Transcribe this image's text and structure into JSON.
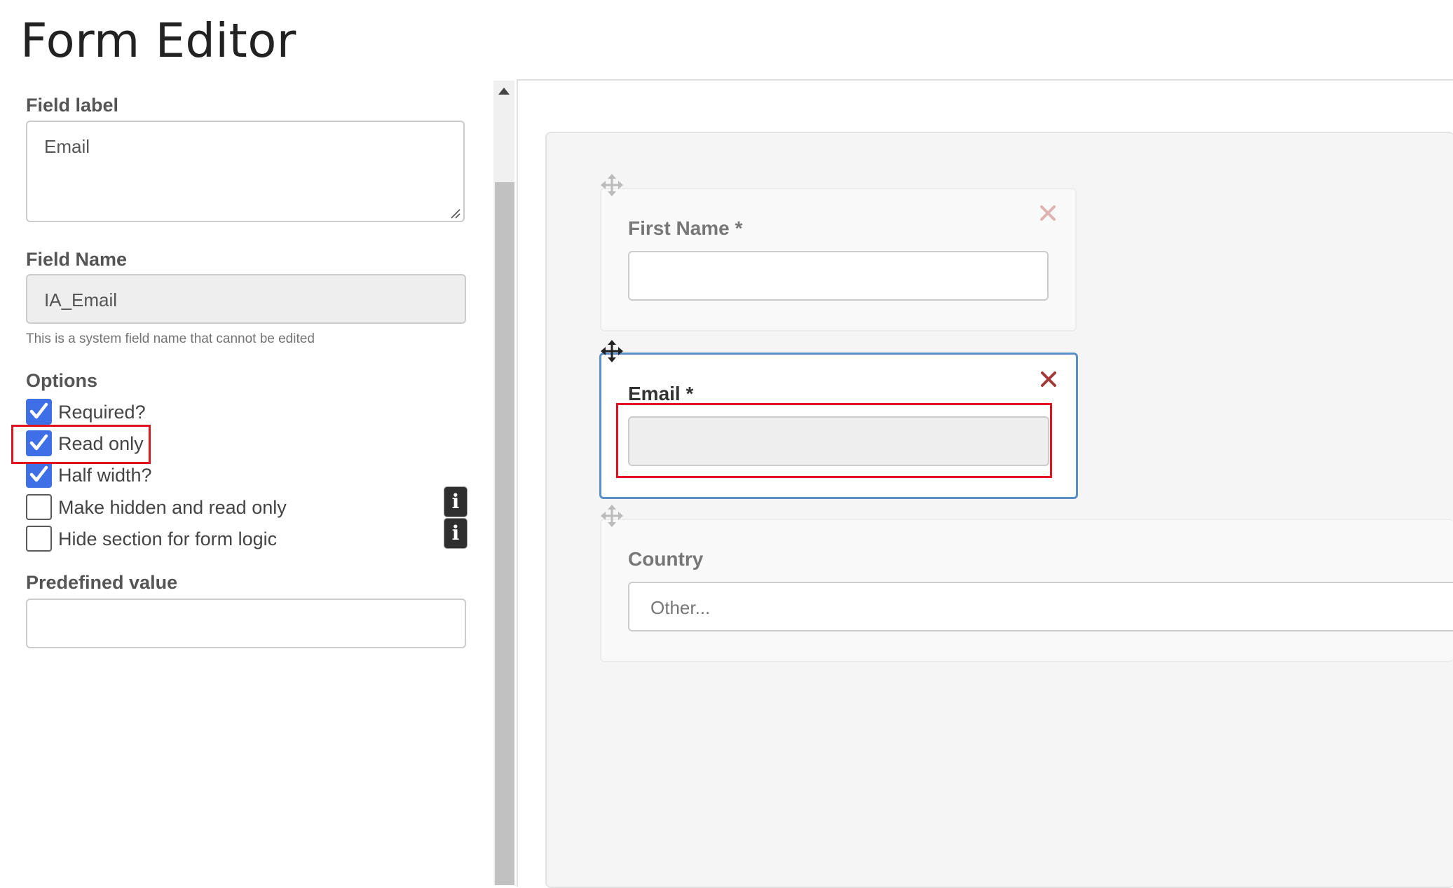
{
  "page": {
    "title": "Form Editor"
  },
  "settings": {
    "field_label": {
      "label": "Field label",
      "value": "Email"
    },
    "field_name": {
      "label": "Field Name",
      "value": "IA_Email",
      "help": "This is a system field name that cannot be edited"
    },
    "options": {
      "label": "Options",
      "items": [
        {
          "label": "Required?",
          "checked": true
        },
        {
          "label": "Read only",
          "checked": true
        },
        {
          "label": "Half width?",
          "checked": true
        },
        {
          "label": "Make hidden and read only",
          "checked": false,
          "info": "i"
        },
        {
          "label": "Hide section for form logic",
          "checked": false,
          "info": "i"
        }
      ]
    },
    "predefined_value": {
      "label": "Predefined value",
      "value": ""
    }
  },
  "preview": {
    "fields": [
      {
        "label": "First Name *",
        "value": "",
        "selected": false
      },
      {
        "label": "Email *",
        "value": "",
        "selected": true,
        "read_only": true
      },
      {
        "label": "Country",
        "value": "Other...",
        "selected": false
      }
    ]
  },
  "colors": {
    "checkbox_checked": "#3f6fe6",
    "selected_border": "#5b8fc7",
    "highlight": "#e0141e",
    "delete_active": "#a33a3a",
    "delete_inactive": "#e0b3b3"
  }
}
